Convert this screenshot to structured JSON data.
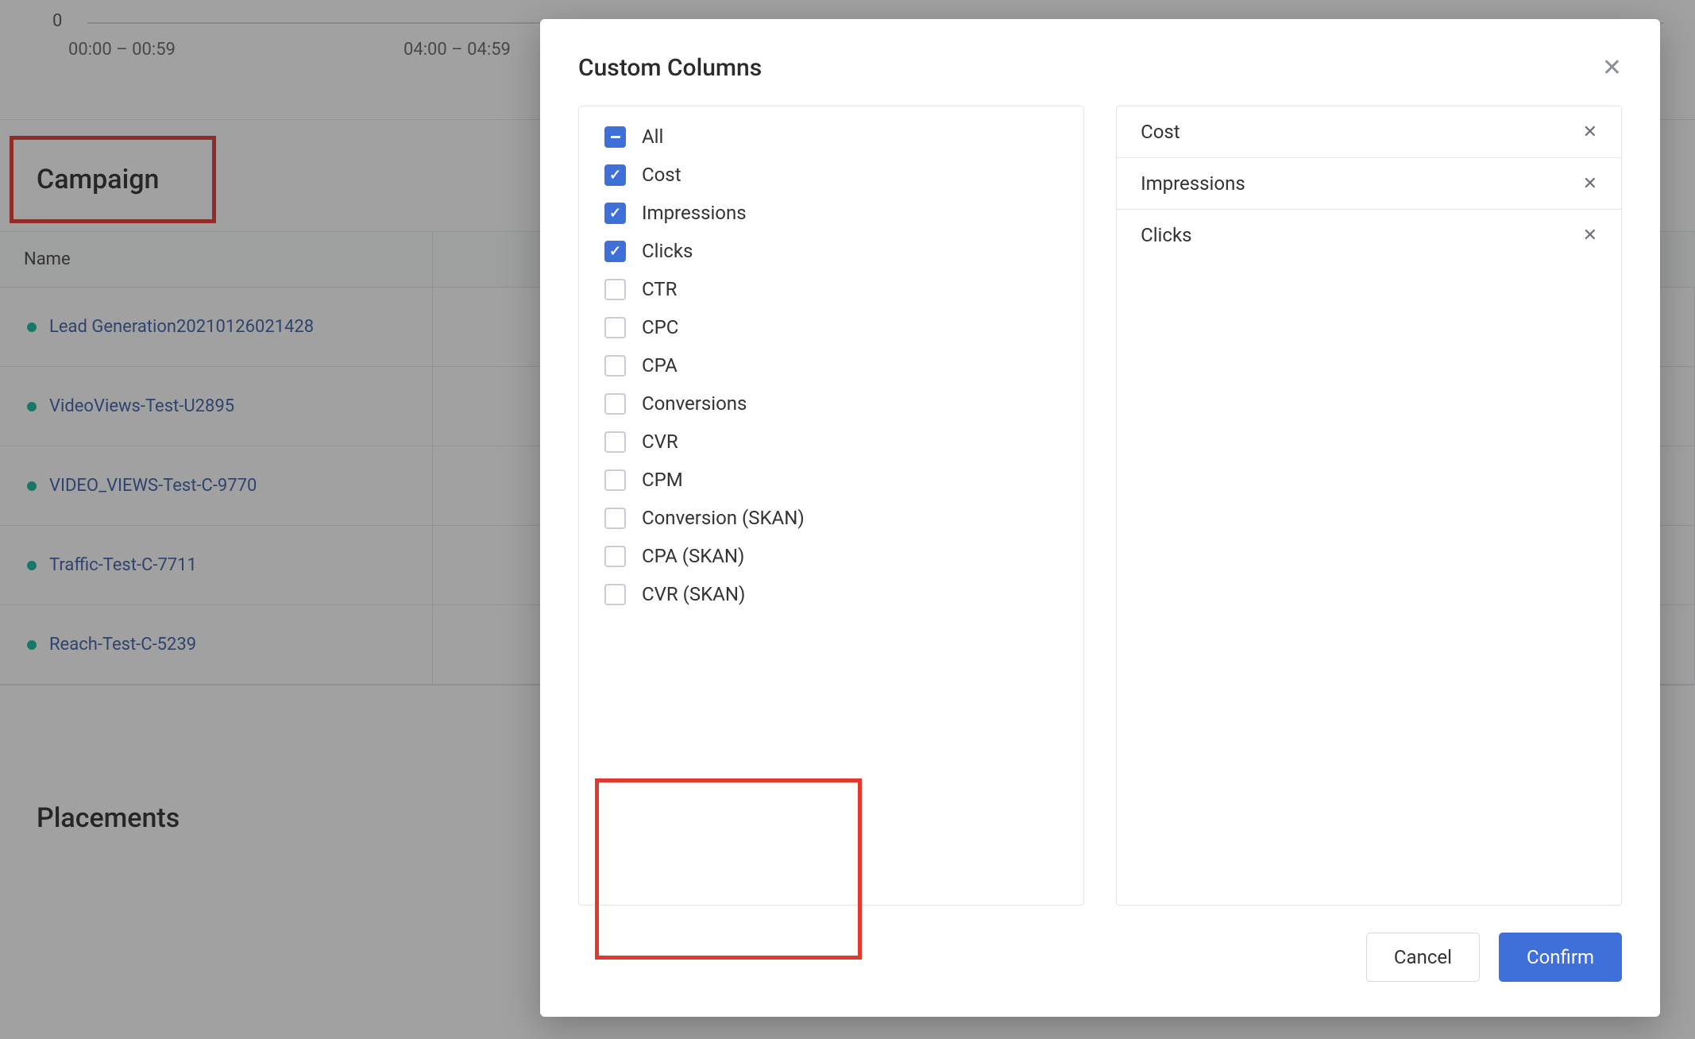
{
  "timeline": {
    "zero": "0",
    "tick1": "00:00 – 00:59",
    "tick2": "04:00 – 04:59"
  },
  "campaign": {
    "heading": "Campaign",
    "name_column": "Name",
    "rows": [
      {
        "label": "Lead Generation20210126021428"
      },
      {
        "label": "VideoViews-Test-U2895"
      },
      {
        "label": "VIDEO_VIEWS-Test-C-9770"
      },
      {
        "label": "Traffic-Test-C-7711"
      },
      {
        "label": "Reach-Test-C-5239"
      }
    ]
  },
  "placements_heading": "Placements",
  "modal": {
    "title": "Custom Columns",
    "options": [
      {
        "label": "All",
        "state": "indeterminate"
      },
      {
        "label": "Cost",
        "state": "checked"
      },
      {
        "label": "Impressions",
        "state": "checked"
      },
      {
        "label": "Clicks",
        "state": "checked"
      },
      {
        "label": "CTR",
        "state": "unchecked"
      },
      {
        "label": "CPC",
        "state": "unchecked"
      },
      {
        "label": "CPA",
        "state": "unchecked"
      },
      {
        "label": "Conversions",
        "state": "unchecked"
      },
      {
        "label": "CVR",
        "state": "unchecked"
      },
      {
        "label": "CPM",
        "state": "unchecked"
      },
      {
        "label": "Conversion (SKAN)",
        "state": "unchecked"
      },
      {
        "label": "CPA (SKAN)",
        "state": "unchecked"
      },
      {
        "label": "CVR (SKAN)",
        "state": "unchecked"
      }
    ],
    "selected": [
      {
        "label": "Cost"
      },
      {
        "label": "Impressions"
      },
      {
        "label": "Clicks"
      }
    ],
    "cancel_label": "Cancel",
    "confirm_label": "Confirm"
  }
}
